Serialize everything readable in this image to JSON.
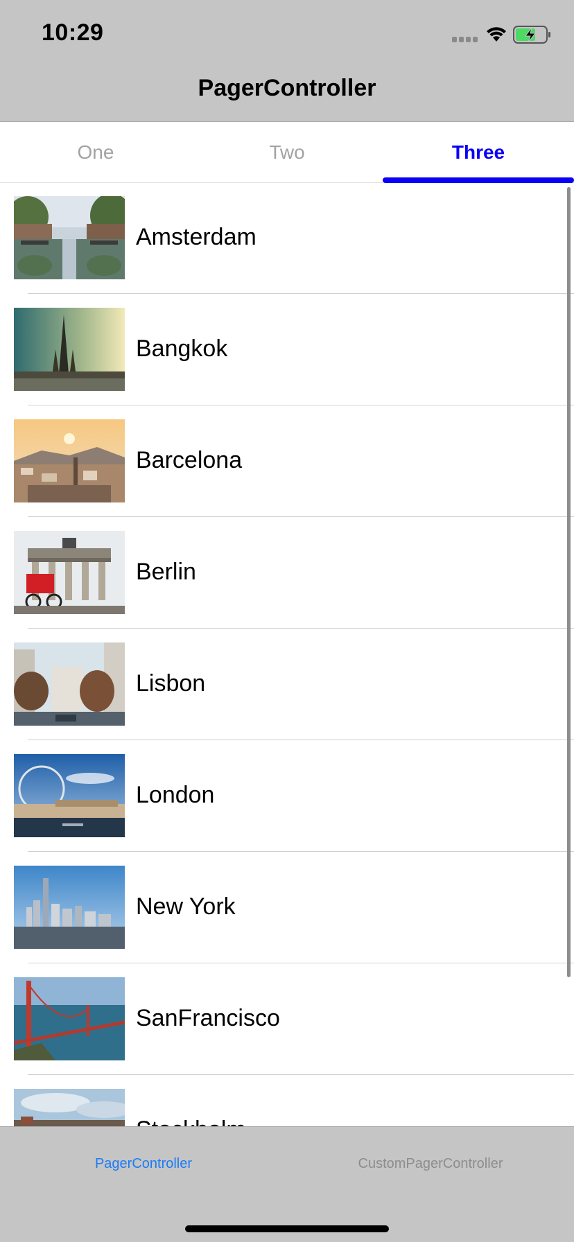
{
  "status_bar": {
    "time": "10:29",
    "icons": [
      "signal-icon",
      "wifi-icon",
      "battery-charging-icon"
    ]
  },
  "nav_bar": {
    "title": "PagerController"
  },
  "pager_tabs": [
    {
      "label": "One",
      "selected": false
    },
    {
      "label": "Two",
      "selected": false
    },
    {
      "label": "Three",
      "selected": true
    }
  ],
  "cities": [
    {
      "name": "Amsterdam",
      "thumb": "amsterdam-canal-photo"
    },
    {
      "name": "Bangkok",
      "thumb": "bangkok-temple-photo"
    },
    {
      "name": "Barcelona",
      "thumb": "barcelona-skyline-photo"
    },
    {
      "name": "Berlin",
      "thumb": "berlin-brandenburg-gate-photo"
    },
    {
      "name": "Lisbon",
      "thumb": "lisbon-street-photo"
    },
    {
      "name": "London",
      "thumb": "london-eye-photo"
    },
    {
      "name": "New York",
      "thumb": "new-york-skyline-photo"
    },
    {
      "name": "SanFrancisco",
      "thumb": "golden-gate-bridge-photo"
    },
    {
      "name": "Stockholm",
      "thumb": "stockholm-photo"
    }
  ],
  "bottom_tabs": [
    {
      "label": "PagerController",
      "selected": true
    },
    {
      "label": "CustomPagerController",
      "selected": false
    }
  ],
  "colors": {
    "accent": "#0a00f5",
    "tabbar_selected": "#1b7cf5",
    "tabbar_unselected": "#8d8d8d",
    "bars_background": "#c5c5c5"
  }
}
